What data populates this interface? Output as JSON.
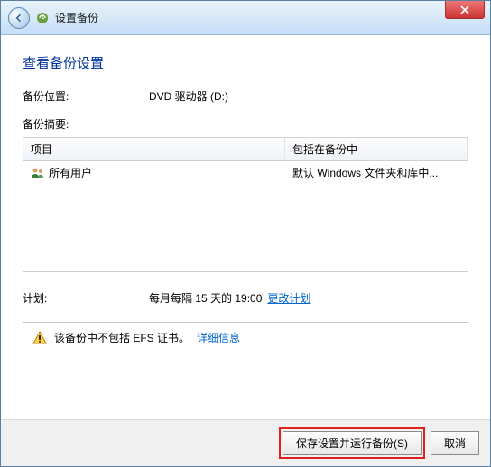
{
  "window": {
    "title": "设置备份"
  },
  "page": {
    "heading": "查看备份设置",
    "location_label": "备份位置:",
    "location_value": "DVD 驱动器 (D:)",
    "summary_label": "备份摘要:"
  },
  "table": {
    "col1": "项目",
    "col2": "包括在备份中",
    "rows": [
      {
        "name": "所有用户",
        "included": "默认 Windows 文件夹和库中..."
      }
    ]
  },
  "schedule": {
    "label": "计划:",
    "value": "每月每隔 15 天的 19:00",
    "change_link": "更改计划"
  },
  "warning": {
    "text": "该备份中不包括 EFS 证书。",
    "detail_link": "详细信息"
  },
  "footer": {
    "primary": "保存设置并运行备份(S)",
    "cancel": "取消"
  }
}
